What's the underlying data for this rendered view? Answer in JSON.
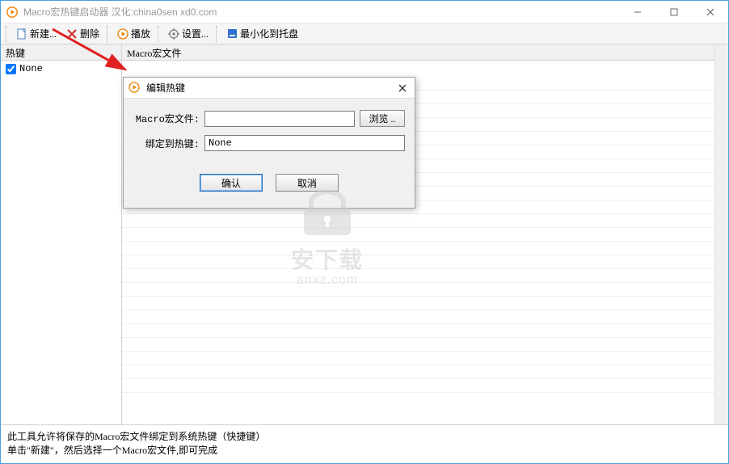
{
  "window": {
    "title": "Macro宏热键启动器 汉化:china0sen xd0.com"
  },
  "toolbar": {
    "new_label": "新建...",
    "delete_label": "删除",
    "play_label": "播放",
    "settings_label": "设置...",
    "minimize_tray_label": "最小化到托盘"
  },
  "panels": {
    "hotkey_header": "热键",
    "macro_header": "Macro宏文件",
    "hotkey_items": [
      {
        "checked": true,
        "label": "None"
      }
    ]
  },
  "dialog": {
    "title": "编辑热键",
    "file_label": "Macro宏文件:",
    "file_value": "",
    "browse_label": "浏览 ..",
    "bind_label": "绑定到热键:",
    "bind_value": "None",
    "ok_label": "确认",
    "cancel_label": "取消"
  },
  "footer": {
    "line1": "此工具允许将保存的Macro宏文件绑定到系统热键（快捷键）",
    "line2": "单击\"新建\"，然后选择一个Macro宏文件,即可完成"
  },
  "watermark": {
    "main": "安下载",
    "sub": "anxz.com"
  },
  "icons": {
    "app": "play-circle-icon",
    "new": "document-new-icon",
    "delete": "delete-x-icon",
    "play": "play-circle-icon",
    "settings": "gear-icon",
    "tray": "minimize-tray-icon"
  },
  "colors": {
    "accent_orange": "#f08000",
    "delete_red": "#d03030",
    "tray_blue": "#3070d0",
    "border_blue": "#4aa0e0"
  }
}
